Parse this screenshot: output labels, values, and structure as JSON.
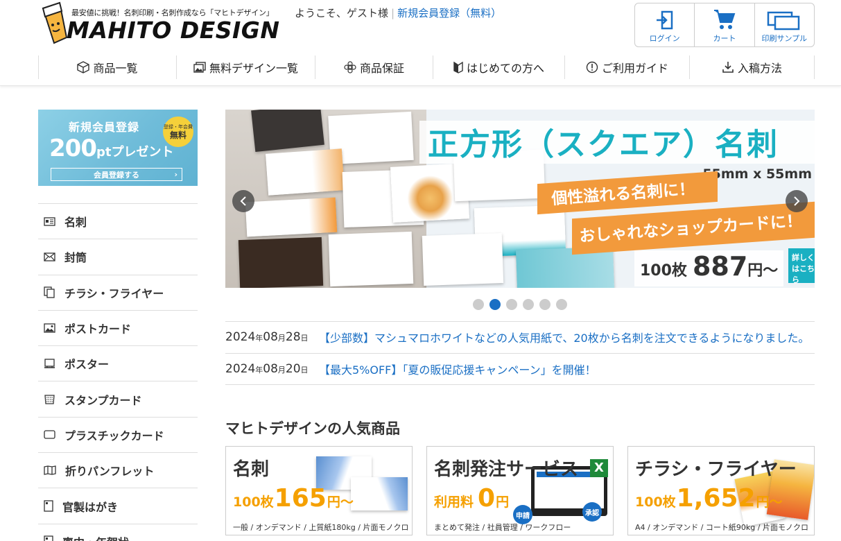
{
  "header": {
    "tagline": "最安値に挑戦！名刺印刷・名刺作成なら「マヒトデザイン」",
    "logo_text": "MAHITO DESIGN",
    "welcome": "ようこそ、ゲスト様",
    "register_link": "新規会員登録（無料）",
    "tools": [
      {
        "label": "ログイン",
        "icon": "login-icon"
      },
      {
        "label": "カート",
        "icon": "cart-icon"
      },
      {
        "label": "印刷サンプル",
        "icon": "print-sample-icon"
      }
    ]
  },
  "nav": [
    {
      "label": "商品一覧",
      "icon": "box-icon"
    },
    {
      "label": "無料デザイン一覧",
      "icon": "images-icon"
    },
    {
      "label": "商品保証",
      "icon": "badge-icon"
    },
    {
      "label": "はじめての方へ",
      "icon": "beginner-icon"
    },
    {
      "label": "ご利用ガイド",
      "icon": "info-icon"
    },
    {
      "label": "入稿方法",
      "icon": "download-icon"
    }
  ],
  "promo": {
    "title": "新規会員登録",
    "badge_top": "登録・年会費",
    "badge_main": "無料",
    "points": "200",
    "points_unit": "ptプレゼント",
    "button": "会員登録する"
  },
  "sidebar": [
    {
      "label": "名刺",
      "icon": "business-card-icon"
    },
    {
      "label": "封筒",
      "icon": "envelope-icon"
    },
    {
      "label": "チラシ・フライヤー",
      "icon": "flyer-icon"
    },
    {
      "label": "ポストカード",
      "icon": "postcard-icon"
    },
    {
      "label": "ポスター",
      "icon": "poster-icon"
    },
    {
      "label": "スタンプカード",
      "icon": "stamp-card-icon"
    },
    {
      "label": "プラスチックカード",
      "icon": "plastic-card-icon"
    },
    {
      "label": "折りパンフレット",
      "icon": "pamphlet-icon"
    },
    {
      "label": "官製はがき",
      "icon": "postal-card-icon"
    },
    {
      "label": "喪中・年賀状",
      "icon": "new-year-card-icon"
    }
  ],
  "hero": {
    "title": "正方形（スクエア）名刺",
    "size": "55mm x 55mm",
    "line1": "個性溢れる名刺に！",
    "line2": "おしゃれなショップカードに！",
    "qty": "100枚",
    "price": "887",
    "price_unit": "円〜",
    "more": "詳しくはこちら",
    "slide_count": 6,
    "active_slide": 2
  },
  "news": [
    {
      "year": "2024",
      "month": "08",
      "day": "28",
      "text": "【少部数】マシュマロホワイトなどの人気用紙で、20枚から名刺を注文できるようになりました。"
    },
    {
      "year": "2024",
      "month": "08",
      "day": "20",
      "text": "【最大5%OFF】「夏の販促応援キャンペーン」を開催！"
    }
  ],
  "date_units": {
    "year": "年",
    "month": "月",
    "day": "日"
  },
  "popular": {
    "title": "マヒトデザインの人気商品",
    "items": [
      {
        "name": "名刺",
        "pre": "100枚",
        "price": "165",
        "unit": "円〜",
        "desc": "一般 / オンデマンド / 上質紙180kg / 片面モノクロ"
      },
      {
        "name": "名刺発注サービス",
        "pre": "利用料",
        "price": "0",
        "unit": "円",
        "desc": "まとめて発注 / 社員管理 / ワークフロー",
        "badge_apply": "申請",
        "badge_approve": "承認"
      },
      {
        "name": "チラシ・フライヤー",
        "pre": "100枚",
        "price": "1,652",
        "unit": "円〜",
        "desc": "A4 / オンデマンド / コート紙90kg / 片面モノクロ"
      }
    ]
  },
  "colors": {
    "link": "#1a6fc4",
    "accent_orange": "#f5a000",
    "hero_teal": "#1ab0c2"
  }
}
